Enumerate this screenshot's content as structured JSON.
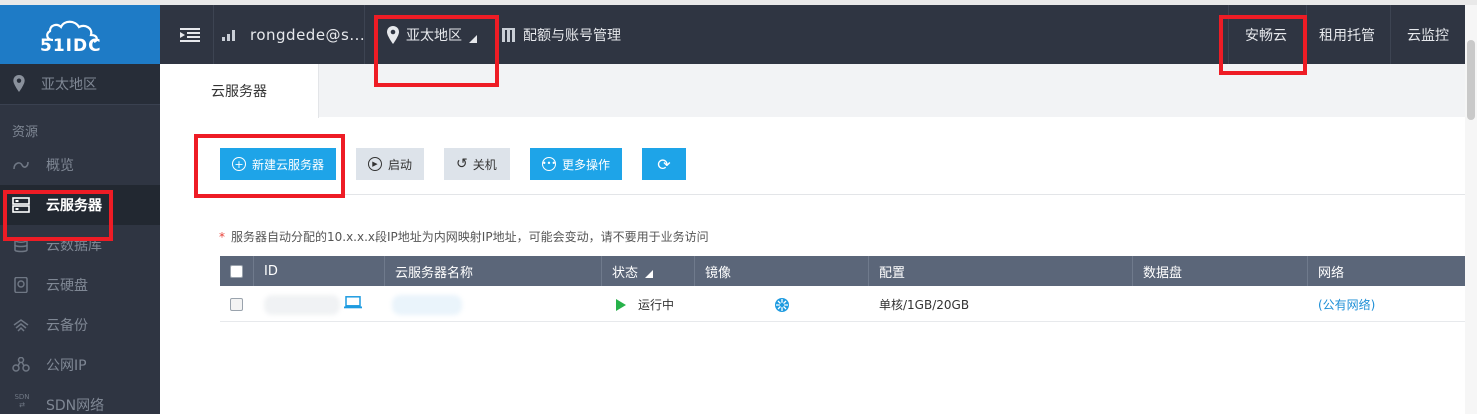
{
  "logo": {
    "text": "51IDC"
  },
  "topbar": {
    "user": "rongdede@s...",
    "region": "亚太地区",
    "quota": "配额与账号管理",
    "links": [
      "安畅云",
      "租用托管",
      "云监控"
    ]
  },
  "sidebar": {
    "region": "亚太地区",
    "group": "资源",
    "items": [
      {
        "label": "概览",
        "icon": "overview-icon"
      },
      {
        "label": "云服务器",
        "icon": "server-icon"
      },
      {
        "label": "云数据库",
        "icon": "database-icon"
      },
      {
        "label": "云硬盘",
        "icon": "disk-icon"
      },
      {
        "label": "云备份",
        "icon": "backup-icon"
      },
      {
        "label": "公网IP",
        "icon": "public-ip-icon"
      },
      {
        "label": "SDN网络",
        "icon": "sdn-icon"
      }
    ],
    "sdn_badge": "SDN"
  },
  "tabs": {
    "active": "云服务器"
  },
  "toolbar": {
    "new": "新建云服务器",
    "start": "启动",
    "shutdown": "关机",
    "more": "更多操作"
  },
  "notice": "服务器自动分配的10.x.x.x段IP地址为内网映射IP地址，可能会变动，请不要用于业务访问",
  "notice_mark": "*",
  "table": {
    "columns": [
      "ID",
      "云服务器名称",
      "状态",
      "镜像",
      "配置",
      "数据盘",
      "网络"
    ],
    "rows": [
      {
        "id": "",
        "name": "",
        "status": "运行中",
        "image": "",
        "config": "单核/1GB/20GB",
        "disk": "",
        "network": "(公有网络)"
      }
    ]
  },
  "colors": {
    "topbar": "#2f3542",
    "logo": "#1e7bc6",
    "primary": "#1ea4e8",
    "table_header": "#5b6679",
    "highlight": "#ee1c25"
  }
}
